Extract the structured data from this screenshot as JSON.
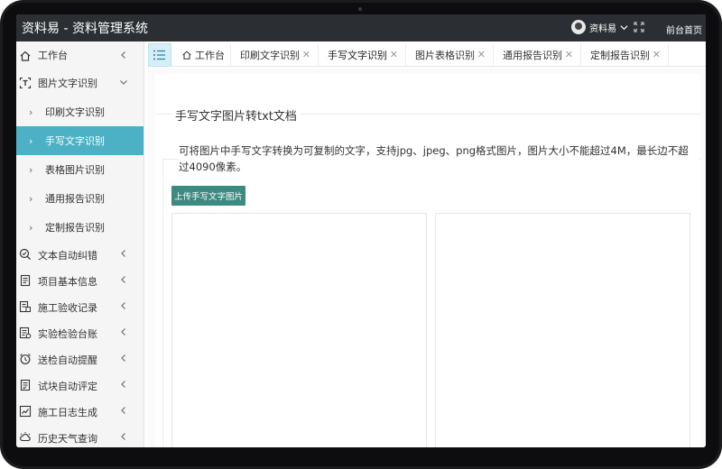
{
  "header": {
    "app_title": "资料易 - 资料管理系统",
    "user_name": "资料易",
    "home_link": "前台首页"
  },
  "sidebar": {
    "items": [
      {
        "label": "工作台",
        "icon": "home-icon",
        "arrow": "chevron-left"
      },
      {
        "label": "图片文字识别",
        "icon": "text-recognition-icon",
        "arrow": "chevron-down",
        "children": [
          {
            "label": "印刷文字识别"
          },
          {
            "label": "手写文字识别",
            "active": true
          },
          {
            "label": "表格图片识别"
          },
          {
            "label": "通用报告识别"
          },
          {
            "label": "定制报告识别"
          }
        ]
      },
      {
        "label": "文本自动纠错",
        "icon": "text-check-icon",
        "arrow": "chevron-left"
      },
      {
        "label": "项目基本信息",
        "icon": "document-icon",
        "arrow": "chevron-left"
      },
      {
        "label": "施工验收记录",
        "icon": "record-icon",
        "arrow": "chevron-left"
      },
      {
        "label": "实验检验台账",
        "icon": "ledger-icon",
        "arrow": "chevron-left"
      },
      {
        "label": "送检自动提醒",
        "icon": "alarm-clock-icon",
        "arrow": "chevron-left"
      },
      {
        "label": "试块自动评定",
        "icon": "evaluate-icon",
        "arrow": "chevron-left"
      },
      {
        "label": "施工日志生成",
        "icon": "log-icon",
        "arrow": "chevron-left"
      },
      {
        "label": "历史天气查询",
        "icon": "weather-icon",
        "arrow": "chevron-left"
      }
    ]
  },
  "tabs": [
    {
      "label": "工作台",
      "icon": "home-icon",
      "closable": false
    },
    {
      "label": "印刷文字识别",
      "closable": true
    },
    {
      "label": "手写文字识别",
      "closable": true,
      "active": true
    },
    {
      "label": "图片表格识别",
      "closable": true
    },
    {
      "label": "通用报告识别",
      "closable": true
    },
    {
      "label": "定制报告识别",
      "closable": true
    }
  ],
  "main": {
    "title": "手写文字图片转txt文档",
    "description": "可将图片中手写文字转换为可复制的文字，支持jpg、jpeg、png格式图片，图片大小不能超过4M，最长边不超过4090像素。",
    "upload_button": "上传手写文字图片"
  },
  "colors": {
    "topbar": "#2b2f33",
    "active_menu": "#4cb1c5",
    "upload_button": "#3d8a80"
  }
}
